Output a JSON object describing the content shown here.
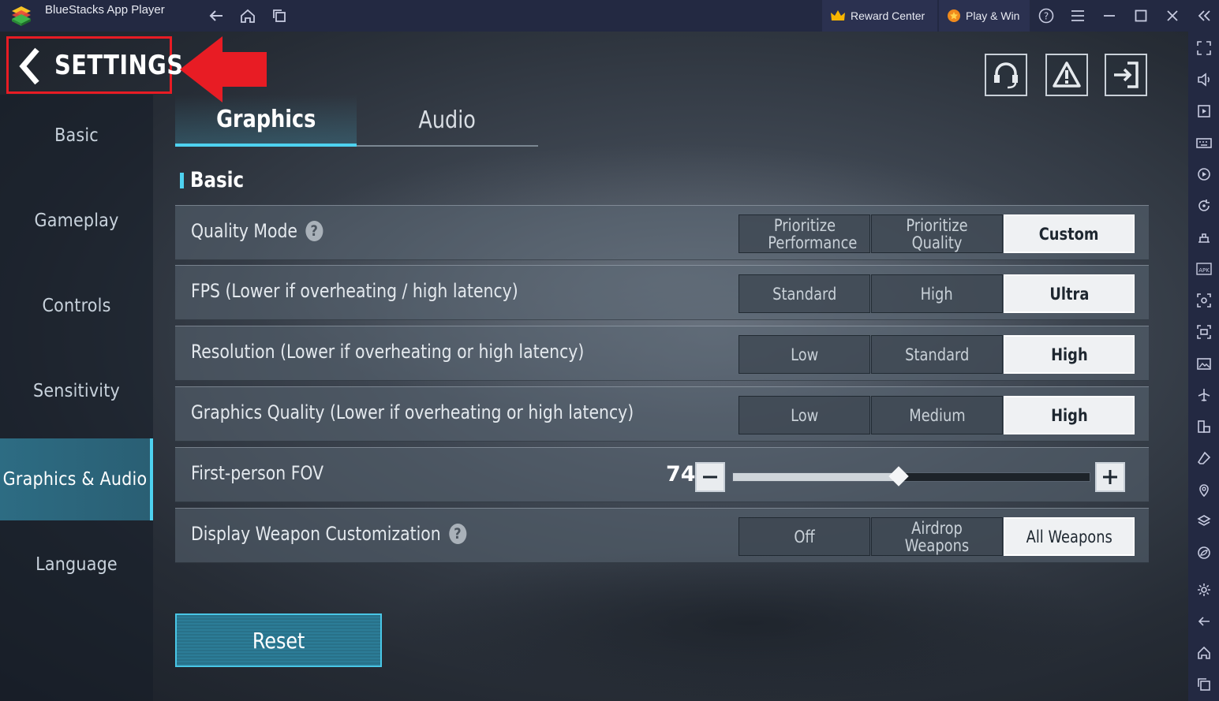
{
  "titlebar": {
    "app_title": "BlueStacks App Player",
    "reward_center": "Reward Center",
    "play_win": "Play & Win"
  },
  "header": {
    "title": "SETTINGS"
  },
  "nav": {
    "items": [
      {
        "label": "Basic",
        "active": false
      },
      {
        "label": "Gameplay",
        "active": false
      },
      {
        "label": "Controls",
        "active": false
      },
      {
        "label": "Sensitivity",
        "active": false
      },
      {
        "label": "Graphics & Audio",
        "active": true
      },
      {
        "label": "Language",
        "active": false
      }
    ]
  },
  "tabs": {
    "graphics": "Graphics",
    "audio": "Audio"
  },
  "section": {
    "title": "Basic"
  },
  "settings": {
    "quality_mode": {
      "label": "Quality Mode",
      "options": [
        "Prioritize Performance",
        "Prioritize Quality",
        "Custom"
      ],
      "selected": "Custom"
    },
    "fps": {
      "label": "FPS (Lower if overheating / high latency)",
      "options": [
        "Standard",
        "High",
        "Ultra"
      ],
      "selected": "Ultra"
    },
    "resolution": {
      "label": "Resolution (Lower if overheating or high latency)",
      "options": [
        "Low",
        "Standard",
        "High"
      ],
      "selected": "High"
    },
    "graphics_quality": {
      "label": "Graphics Quality (Lower if overheating or high latency)",
      "options": [
        "Low",
        "Medium",
        "High"
      ],
      "selected": "High"
    },
    "fov": {
      "label": "First-person FOV",
      "value": "74",
      "slider_fraction": 0.465
    },
    "weapon_custom": {
      "label": "Display Weapon Customization",
      "options": [
        "Off",
        "Airdrop Weapons",
        "All Weapons"
      ],
      "selected": "All Weapons"
    }
  },
  "reset_label": "Reset",
  "colors": {
    "accent": "#4ed2f0",
    "highlight_red": "#e81c24",
    "titlebar": "#232942"
  },
  "icons": {
    "titlebar": [
      "back-icon",
      "home-icon",
      "multi-instance-icon",
      "help-icon",
      "menu-icon",
      "minimize-icon",
      "maximize-icon",
      "close-icon",
      "collapse-sidebar-icon"
    ],
    "header": [
      "customer-service-icon",
      "report-icon",
      "exit-icon"
    ],
    "rightbar": [
      "fullscreen-icon",
      "volume-icon",
      "media-icon",
      "keyboard-icon",
      "macro-icon",
      "rotate-icon",
      "game-controls-icon",
      "apk-icon",
      "screenshot-icon",
      "record-icon",
      "media-folder-icon",
      "airplane-icon",
      "multi-instance-sync-icon",
      "eraser-icon",
      "location-icon",
      "layers-icon",
      "eco-mode-icon",
      "settings-icon",
      "back-icon",
      "home-icon",
      "recent-apps-icon"
    ]
  }
}
